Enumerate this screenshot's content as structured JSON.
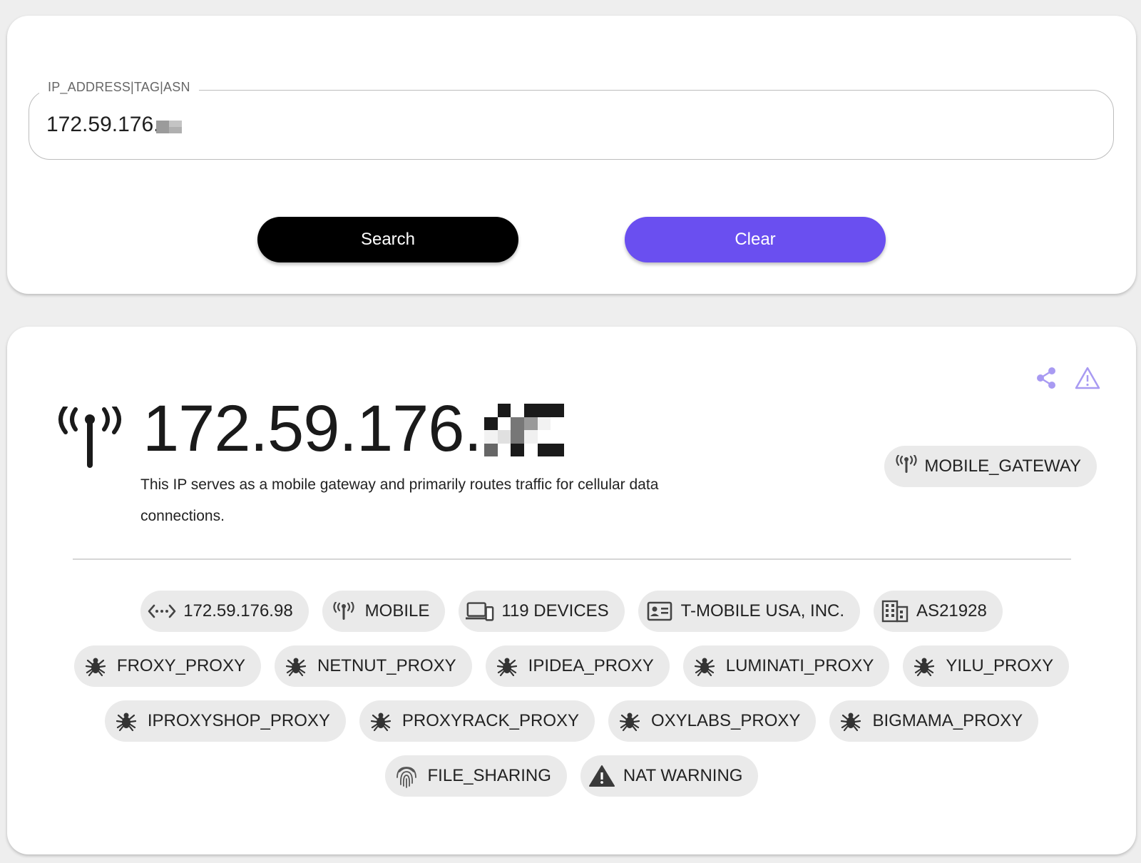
{
  "search": {
    "label": "IP_ADDRESS|TAG|ASN",
    "value": "172.59.176.",
    "search_label": "Search",
    "clear_label": "Clear"
  },
  "result": {
    "ip": "172.59.176.",
    "description": "This IP serves as a mobile gateway and primarily routes traffic for cellular data connections.",
    "type_chip": "MOBILE_GATEWAY",
    "actions": {
      "share_icon": "share-icon",
      "report_icon": "warning-triangle-icon"
    },
    "tag_rows": [
      [
        {
          "label": "172.59.176.98",
          "icon": "code-arrows-icon"
        },
        {
          "label": "MOBILE",
          "icon": "antenna-icon"
        },
        {
          "label": "119 DEVICES",
          "icon": "devices-icon"
        },
        {
          "label": "T-MOBILE USA, INC.",
          "icon": "id-card-icon"
        },
        {
          "label": "AS21928",
          "icon": "building-icon"
        }
      ],
      [
        {
          "label": "FROXY_PROXY",
          "icon": "spider-icon"
        },
        {
          "label": "NETNUT_PROXY",
          "icon": "spider-icon"
        },
        {
          "label": "IPIDEA_PROXY",
          "icon": "spider-icon"
        },
        {
          "label": "LUMINATI_PROXY",
          "icon": "spider-icon"
        },
        {
          "label": "YILU_PROXY",
          "icon": "spider-icon"
        }
      ],
      [
        {
          "label": "IPROXYSHOP_PROXY",
          "icon": "spider-icon"
        },
        {
          "label": "PROXYRACK_PROXY",
          "icon": "spider-icon"
        },
        {
          "label": "OXYLABS_PROXY",
          "icon": "spider-icon"
        },
        {
          "label": "BIGMAMA_PROXY",
          "icon": "spider-icon"
        }
      ],
      [
        {
          "label": "FILE_SHARING",
          "icon": "fingerprint-icon"
        },
        {
          "label": "NAT WARNING",
          "icon": "warning-icon"
        }
      ]
    ]
  },
  "colors": {
    "accent": "#6a4ff0",
    "chip_bg": "#eaeaea",
    "page_bg": "#eeeeee"
  }
}
